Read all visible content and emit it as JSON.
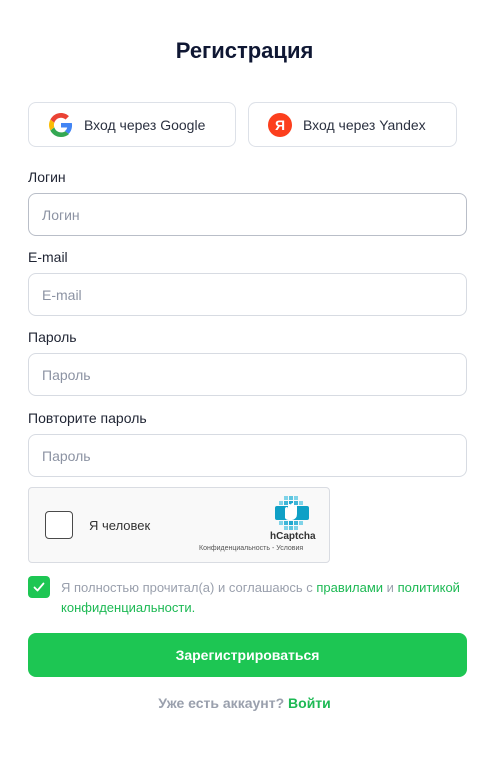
{
  "page": {
    "title": "Регистрация"
  },
  "oauth": {
    "google_label": "Вход через Google",
    "yandex_label": "Вход через Yandex",
    "yandex_letter": "Я"
  },
  "fields": {
    "login": {
      "label": "Логин",
      "placeholder": "Логин",
      "value": ""
    },
    "email": {
      "label": "E-mail",
      "placeholder": "E-mail",
      "value": ""
    },
    "password": {
      "label": "Пароль",
      "placeholder": "Пароль",
      "value": ""
    },
    "password_repeat": {
      "label": "Повторите пароль",
      "placeholder": "Пароль",
      "value": ""
    }
  },
  "captcha": {
    "label": "Я человек",
    "brand": "hCaptcha",
    "links": "Конфиденциальность - Условия",
    "checked": false
  },
  "terms": {
    "checked": true,
    "text_before": "Я полностью прочитал(а) и соглашаюсь с ",
    "rules_link": "правилами",
    "text_and": " и ",
    "privacy_link": "политикой конфиденциальности",
    "text_end": "."
  },
  "submit": {
    "label": "Зарегистрироваться"
  },
  "footer": {
    "question": "Уже есть аккаунт? ",
    "login_link": "Войти"
  },
  "colors": {
    "accent": "#1dc653",
    "title": "#0f1733",
    "muted": "#9aa0ad"
  }
}
